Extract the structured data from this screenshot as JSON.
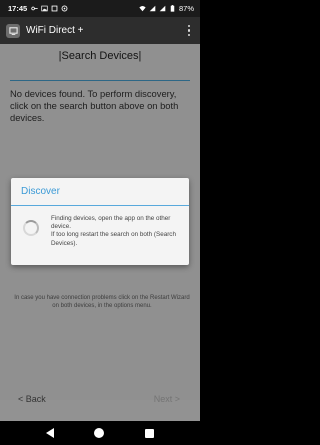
{
  "status_bar": {
    "time": "17:45",
    "battery": "87%",
    "left_icons": [
      "vpn-key-icon",
      "image-icon",
      "square-icon",
      "settings-circle-icon"
    ],
    "right_icons": [
      "wifi-icon",
      "signal-icon",
      "signal-icon",
      "battery-icon"
    ]
  },
  "app_bar": {
    "title": "WiFi Direct +"
  },
  "page": {
    "heading": "|Search Devices|",
    "info": "No devices found. To perform discovery, click on the search button above on both devices.",
    "obscured_hint": "In case you have connection problems click on the Restart Wizard on both devices, in the options menu."
  },
  "navigation": {
    "back_label": "< Back",
    "next_label": "Next >"
  },
  "dialog": {
    "title": "Discover",
    "message": "Finding devices, open the app on the other device.\nIf too long restart the search on both (Search Devices)."
  },
  "colors": {
    "accent": "#3b9ad6",
    "statusbar": "#1b1b1b",
    "appbar": "#2d2d2d"
  }
}
